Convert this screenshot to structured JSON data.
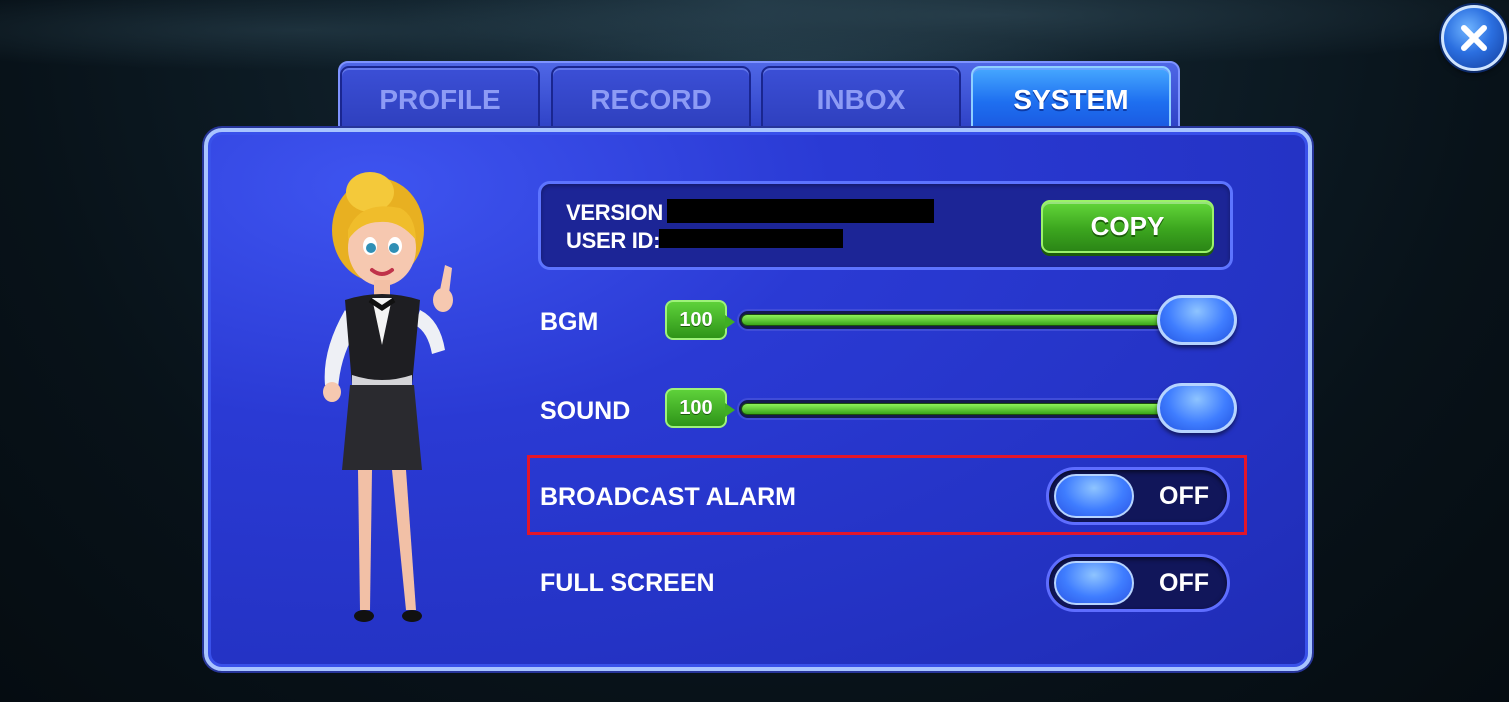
{
  "tabs": [
    {
      "label": "PROFILE",
      "active": false
    },
    {
      "label": "RECORD",
      "active": false
    },
    {
      "label": "INBOX",
      "active": false
    },
    {
      "label": "SYSTEM",
      "active": true
    }
  ],
  "info": {
    "version_label": "VERSION :",
    "user_id_label": "USER ID:",
    "copy_label": "COPY"
  },
  "settings": {
    "bgm": {
      "label": "BGM",
      "value": "100",
      "level": 100
    },
    "sound": {
      "label": "SOUND",
      "value": "100",
      "level": 100
    },
    "broadcast_alarm": {
      "label": "BROADCAST ALARM",
      "state": "OFF"
    },
    "full_screen": {
      "label": "FULL SCREEN",
      "state": "OFF"
    }
  },
  "icons": {
    "close": "close-icon",
    "character": "hostess-character"
  },
  "colors": {
    "panel": "#2a3ad4",
    "tab_active": "#1e6ff0",
    "copy_button": "#3ca61f",
    "slider_fill": "#3aa51b",
    "highlight": "#e3162a"
  }
}
